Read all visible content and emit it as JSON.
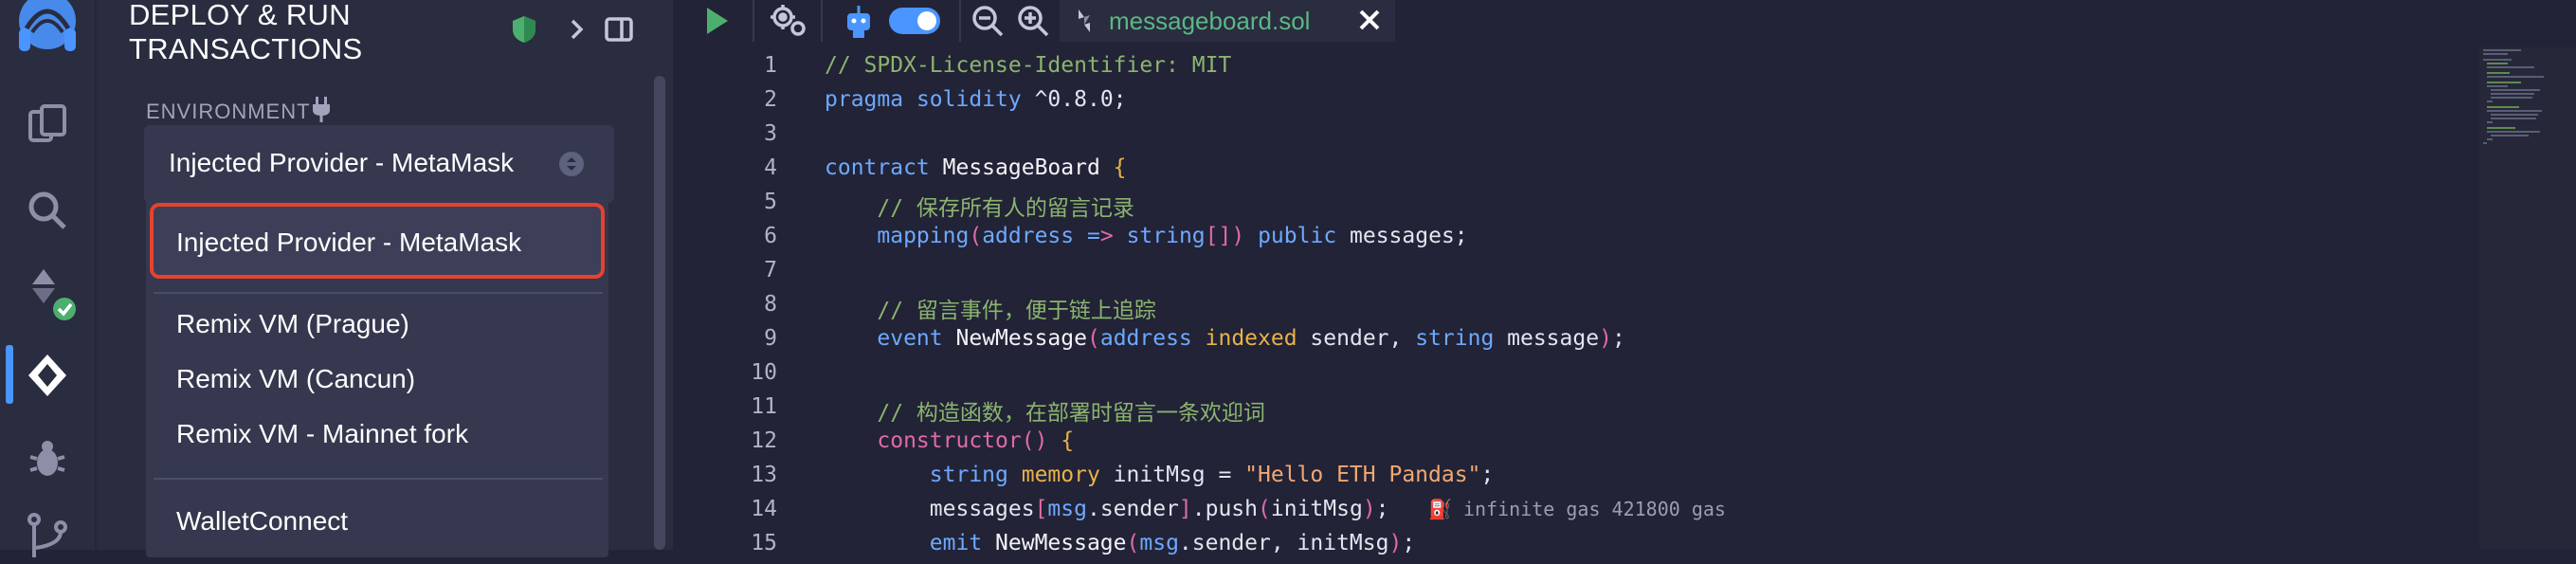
{
  "panel": {
    "title_line1": "DEPLOY & RUN",
    "title_line2": "TRANSACTIONS",
    "environment_label": "ENVIRONMENT",
    "environment_selected": "Injected Provider - MetaMask",
    "dropdown": {
      "selected": "Injected Provider - MetaMask",
      "items": [
        "Remix VM (Prague)",
        "Remix VM (Cancun)",
        "Remix VM - Mainnet fork"
      ],
      "after_divider": "WalletConnect"
    }
  },
  "editor": {
    "tab": {
      "filename": "messageboard.sol"
    },
    "gas_hint": "infinite gas 421800 gas",
    "line_numbers": [
      "1",
      "2",
      "3",
      "4",
      "5",
      "6",
      "7",
      "8",
      "9",
      "10",
      "11",
      "12",
      "13",
      "14",
      "15"
    ]
  },
  "colors": {
    "accent_blue": "#4a95ff",
    "highlight_red": "#e6422e",
    "run_green": "#4caf6e",
    "file_tab_green": "#5bb784"
  },
  "icons": [
    "remix-logo-icon",
    "file-explorer-icon",
    "search-icon",
    "solidity-compiler-icon",
    "deploy-run-icon",
    "debugger-icon",
    "git-icon",
    "shield-icon",
    "chevron-right-icon",
    "panel-toggle-icon",
    "plug-icon",
    "run-icon",
    "settings-gear-icon",
    "ai-assistant-icon",
    "toggle-switch-icon",
    "zoom-out-icon",
    "zoom-in-icon",
    "close-icon"
  ]
}
